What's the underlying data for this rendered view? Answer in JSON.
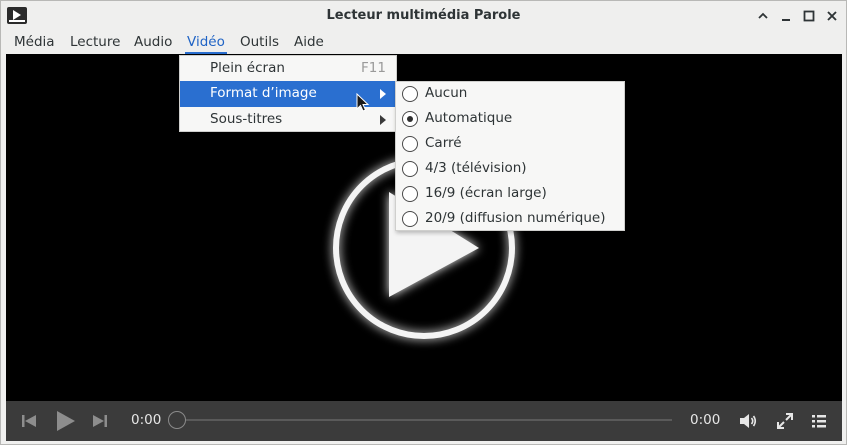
{
  "window": {
    "title": "Lecteur multimédia Parole"
  },
  "menubar": {
    "items": [
      {
        "label": "Média"
      },
      {
        "label": "Lecture"
      },
      {
        "label": "Audio"
      },
      {
        "label": "Vidéo"
      },
      {
        "label": "Outils"
      },
      {
        "label": "Aide"
      }
    ],
    "active": "Vidéo"
  },
  "video_menu": {
    "items": [
      {
        "label": "Plein écran",
        "shortcut": "F11"
      },
      {
        "label": "Format d’image",
        "highlighted": true
      },
      {
        "label": "Sous-titres"
      }
    ]
  },
  "format_menu": {
    "items": [
      {
        "label": "Aucun",
        "selected": false
      },
      {
        "label": "Automatique",
        "selected": true
      },
      {
        "label": "Carré",
        "selected": false
      },
      {
        "label": "4/3 (télévision)",
        "selected": false
      },
      {
        "label": "16/9 (écran large)",
        "selected": false
      },
      {
        "label": "20/9 (diffusion numérique)",
        "selected": false
      }
    ]
  },
  "controls": {
    "current_time": "0:00",
    "total_time": "0:00",
    "progress": 0
  },
  "colors": {
    "accent": "#2a6fd0",
    "video_bg": "#000000",
    "controls_bg": "#3b3b3b"
  },
  "icons": {
    "app": "parole-icon",
    "titlebar": [
      "keep-above-icon",
      "minimize-icon",
      "maximize-icon",
      "close-icon"
    ],
    "controls": [
      "previous-icon",
      "play-icon",
      "next-icon",
      "volume-icon",
      "fullscreen-icon",
      "playlist-icon"
    ]
  }
}
